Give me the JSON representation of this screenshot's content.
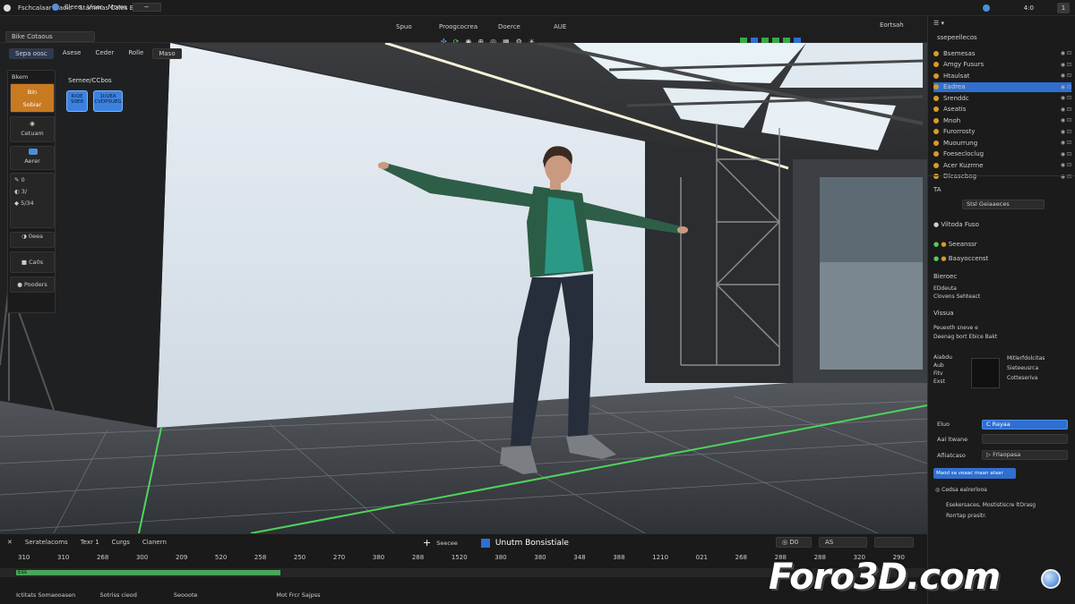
{
  "titlebar": {
    "app_title": "Fschcalaar Maoic",
    "menu1": "Stammas Cales Eristeec",
    "user_label": "4:0",
    "min_label": "1"
  },
  "menubar": {
    "items": [
      "Eleeo",
      "Visar",
      "Moros"
    ],
    "dropdown": "~"
  },
  "toolbar": {
    "workspace_btn": "Bike Cotaous",
    "center_a": "Spuo",
    "center_b": "Proogcocrea",
    "center_c": "Doerce",
    "center_d": "AUE",
    "right_label": "Eortsah"
  },
  "viewport_tabs": [
    "Sepa oosc",
    "Asese",
    "Ceder",
    "Rolle",
    "Maso"
  ],
  "left_tools": {
    "header": "Bkem",
    "tool1_label": "Bin",
    "tool1_sub": "Sobiar",
    "tool2_label": "Cetuam",
    "tool3_label": "Aerer",
    "tool4_nums": [
      "0",
      "3/",
      "5/34"
    ],
    "tool5_label": "0eea",
    "tool6_label": "Ca0s",
    "tool7_label": "Pooders"
  },
  "overlay": {
    "heading": "Semee/CCbos",
    "badge1": "RiOE\nS0E8",
    "badge2": "1I/UEA\nCVDPSUEG"
  },
  "outliner": {
    "title": "ssepeellecos",
    "items": [
      {
        "label": "Bsemesas"
      },
      {
        "label": "Amgy Fusurs"
      },
      {
        "label": "Htaulsat"
      },
      {
        "label": "Eadrea"
      },
      {
        "label": "Srenddc"
      },
      {
        "label": "Aseatis"
      },
      {
        "label": "Mnoh"
      },
      {
        "label": "Furorrosty"
      },
      {
        "label": "Muourrung"
      },
      {
        "label": "Foesecloclug"
      },
      {
        "label": "Acer Kuzrrne"
      },
      {
        "label": "Dleasebog"
      }
    ],
    "selected_index": 3
  },
  "properties": {
    "tab_label": "TA",
    "field_label": "Stsl Geiaaeces",
    "section1": "Viltoda Fuso",
    "item1": "Seeanssr",
    "item2": "Baayoccenst",
    "section2": "Bieroec",
    "sub2a": "EDdeuta",
    "sub2b": "Clovens Sehteact",
    "section3": "Vissua",
    "sub3a": "Peueoth sneve e",
    "sub3b": "Deenag bort Ebice Bakt",
    "grid_labels": [
      "Aiabdu",
      "Aub",
      "Fitv",
      "Exst"
    ],
    "grid_right": [
      "Mitlerfdolcitas",
      "Sieteeusrca",
      "Cotteseriva"
    ],
    "btn_label1": "Eluo",
    "btn_value1": "C Rayaa",
    "label2": "Aal ltwane",
    "label3": "Afliatcaso",
    "value3": "▷ Frlaopasa",
    "blue_btn": "Maod sa veaac maan ataar",
    "footer1": "Cedsa ealrerlooa",
    "footer2": "Esekersaces, Mostistiscre ltOrasg\nRorrtap prasitr."
  },
  "timeline": {
    "tabs": [
      "Seratelacoms",
      "Texr 1",
      "Curgs",
      "Cianern"
    ],
    "add_label": "Seecee",
    "title": "Unutm Bonsistiale",
    "btn_a": "D0",
    "btn_b": "AS",
    "ruler": [
      "310",
      "310",
      "268",
      "300",
      "209",
      "520",
      "258",
      "250",
      "270",
      "380",
      "288",
      "1520",
      "380",
      "380",
      "348",
      "388",
      "1210",
      "021",
      "268",
      "288",
      "288",
      "320",
      "290"
    ],
    "bottom": [
      "Ictitats Somaooasen",
      "Sotriss cieod",
      "Seooote",
      "Mot Frcr Sajpss"
    ],
    "track_label": "Ess"
  },
  "watermark": "Foro3D.com",
  "colors": {
    "accent_blue": "#2f6fd0",
    "accent_orange": "#c87a20",
    "panel": "#1b1b1b",
    "green_line": "#4fd35a"
  }
}
